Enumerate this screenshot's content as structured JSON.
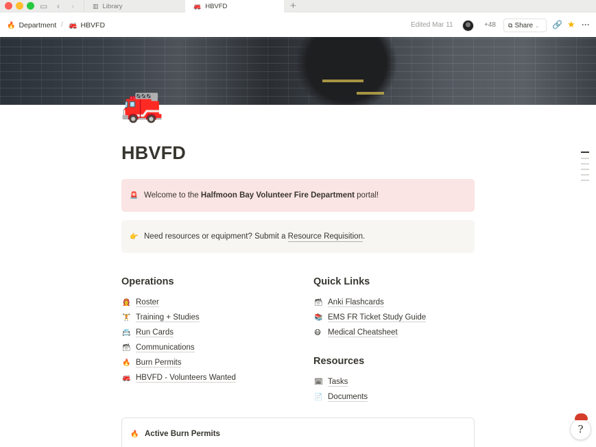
{
  "tabbar": {
    "tabs": [
      {
        "icon": "library-icon",
        "label": "Library",
        "active": false
      },
      {
        "icon": "🚒",
        "label": "HBVFD",
        "active": true
      }
    ],
    "new_tab": "+"
  },
  "topbar": {
    "breadcrumb": [
      {
        "icon": "🔥",
        "label": "Department"
      },
      {
        "icon": "🚒",
        "label": "HBVFD"
      }
    ],
    "separator": "/",
    "edited": "Edited Mar 11",
    "collaborators_count": "+48",
    "share_label": "Share"
  },
  "page": {
    "icon": "🚒",
    "title": "HBVFD"
  },
  "callouts": {
    "welcome": {
      "icon": "🚨",
      "prefix": "Welcome to the ",
      "bold": "Halfmoon Bay Volunteer Fire Department",
      "suffix": " portal!"
    },
    "resources": {
      "icon": "👉",
      "prefix": "Need resources or equipment? Submit a ",
      "link": "Resource Requisition",
      "suffix": "."
    }
  },
  "operations": {
    "heading": "Operations",
    "items": [
      {
        "icon": "👩‍🚒",
        "label": "Roster"
      },
      {
        "icon": "🏋",
        "label": "Training + Studies"
      },
      {
        "icon": "📇",
        "label": "Run Cards"
      },
      {
        "icon": "🗃",
        "label": "Communications"
      },
      {
        "icon": "🔥",
        "label": "Burn Permits"
      },
      {
        "icon": "🚒",
        "label": "HBVFD - Volunteers Wanted"
      }
    ]
  },
  "quick_links": {
    "heading": "Quick Links",
    "items": [
      {
        "icon": "🗃",
        "label": "Anki Flashcards"
      },
      {
        "icon": "📚",
        "label": "EMS FR Ticket Study Guide"
      },
      {
        "icon": "😷",
        "label": "Medical Cheatsheet"
      }
    ]
  },
  "resources": {
    "heading": "Resources",
    "items": [
      {
        "icon": "🗓",
        "label": "Tasks"
      },
      {
        "icon": "📄",
        "label": "Documents"
      }
    ]
  },
  "card": {
    "icon": "🔥",
    "title": "Active Burn Permits"
  },
  "help": {
    "label": "?"
  },
  "colors": {
    "callout_red_bg": "#fbe4e4",
    "callout_gray_bg": "#f7f6f3",
    "text": "#37352f",
    "favorite_star": "#f5b400"
  }
}
